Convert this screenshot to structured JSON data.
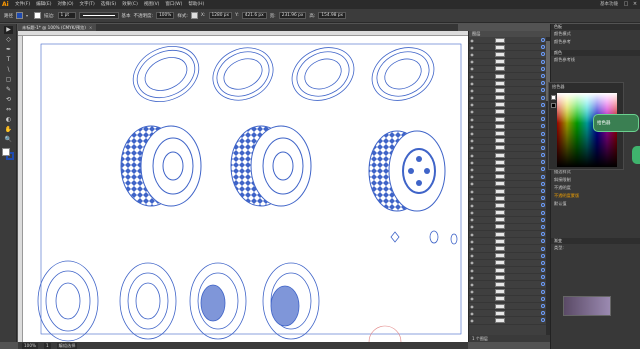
{
  "app": {
    "logo": "Ai",
    "menu": [
      "文件(F)",
      "编辑(E)",
      "对象(O)",
      "文字(T)",
      "选择(S)",
      "效果(C)",
      "视图(V)",
      "窗口(W)",
      "帮助(H)"
    ],
    "workspace": "基本功能"
  },
  "controlbar": {
    "selection_label": "路径",
    "stroke_label": "描边:",
    "stroke_value": "1 pt",
    "style_label": "基本",
    "opacity_label": "不透明度:",
    "opacity_value": "100%",
    "style2_label": "样式:",
    "x_label": "X:",
    "x_value": "1280 px",
    "y_label": "Y:",
    "y_value": "421.6 px",
    "w_label": "宽:",
    "w_value": "231.96 px",
    "h_label": "高:",
    "h_value": "154.98 px"
  },
  "document_tab": {
    "title": "未标题-1* @ 100% (CMYK/预览)",
    "close": "×"
  },
  "tools": [
    "▶",
    "◇",
    "✒",
    "T",
    "\\",
    "▢",
    "✎",
    "⟲",
    "⇔",
    "◐",
    "✋",
    "🔍"
  ],
  "status": {
    "zoom": "100%",
    "page": "1",
    "mode": "编组选择"
  },
  "layers_panel": {
    "title": "图层",
    "footer": "1 个图层",
    "rows": 40
  },
  "right_panels": {
    "tab1": "色板",
    "tab2": "颜色",
    "label1": "颜色模式",
    "label2": "颜色参考",
    "label3": "颜色参考线",
    "picker_title": "拾色器",
    "item1": "描边粗细",
    "item2": "描边样式",
    "item3": "斜接限制",
    "item4": "不透明度",
    "warning": "不透明度蒙版",
    "item5": "默认值",
    "gradient_tab": "渐变",
    "gradient_label": "类型:"
  },
  "tooltip": {
    "label": "拾色器"
  },
  "colors": {
    "accent": "#1f4bb0",
    "canvas": "#ffffff",
    "ui_bg": "#535353",
    "path_blue": "#3f64c8"
  }
}
